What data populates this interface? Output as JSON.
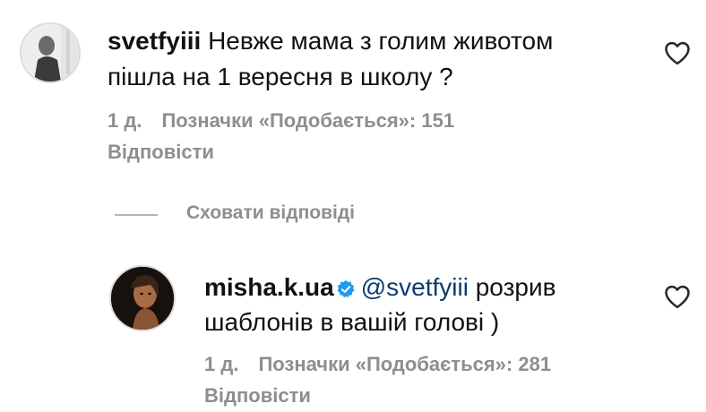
{
  "comments": [
    {
      "username": "svetfyiii",
      "text_line1": "Невже мама з голим животом",
      "text_line2": "пішла на 1 вересня в школу ?",
      "time": "1 д.",
      "likes": "Позначки «Подобається»: 151",
      "reply": "Відповісти",
      "verified": false
    },
    {
      "username": "misha.k.ua",
      "mention": "@svetfyiii",
      "text_line1_rest": "розрив",
      "text_line2": "шаблонів в вашій голові )",
      "time": "1 д.",
      "likes": "Позначки «Подобається»: 281",
      "reply": "Відповісти",
      "verified": true
    }
  ],
  "hide_replies": "Сховати відповіді",
  "colors": {
    "text": "#111111",
    "muted": "#8e8e8e",
    "mention": "#0c3a6e",
    "verified": "#1d9bf0"
  },
  "icons": [
    "heart-outline-icon",
    "verified-badge-icon",
    "avatar"
  ]
}
